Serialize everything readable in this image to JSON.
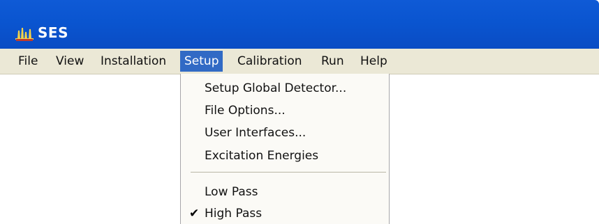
{
  "window": {
    "title": "SES",
    "icon": "ses-app-icon"
  },
  "menubar": {
    "items": [
      {
        "label": "File"
      },
      {
        "label": "View"
      },
      {
        "label": "Installation"
      },
      {
        "label": "Setup",
        "active": true
      },
      {
        "label": "Calibration"
      },
      {
        "label": "Run"
      },
      {
        "label": "Help"
      }
    ]
  },
  "setup_menu": {
    "group1": [
      {
        "label": "Setup Global Detector..."
      },
      {
        "label": "File Options..."
      },
      {
        "label": "User Interfaces..."
      },
      {
        "label": "Excitation Energies"
      }
    ],
    "group2": [
      {
        "label": "Low Pass",
        "checked": false
      },
      {
        "label": "High Pass",
        "checked": true
      }
    ]
  },
  "colors": {
    "titlebar": "#0a55d0",
    "menubar": "#ebe8d6",
    "highlight": "#316ac5",
    "menu_background": "#fbfaf6"
  }
}
